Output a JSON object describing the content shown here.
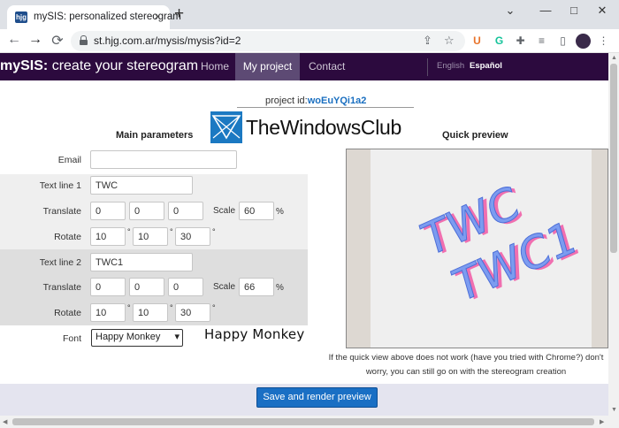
{
  "browser": {
    "tab_favicon": "hjg",
    "tab_title": "mySIS: personalized stereogram",
    "tab_close": "×",
    "new_tab": "+",
    "url": "st.hjg.com.ar/mysis/mysis?id=2",
    "window_controls": {
      "dropdown": "⌄",
      "minimize": "—",
      "maximize": "□",
      "close": "✕"
    },
    "nav": {
      "back": "←",
      "forward": "→",
      "reload": "⟳"
    },
    "extensions": [
      {
        "name": "ublock-icon",
        "glyph": "U",
        "color": "#e8732a"
      },
      {
        "name": "grammarly-icon",
        "glyph": "G",
        "color": "#15c39a"
      },
      {
        "name": "puzzle-icon",
        "glyph": "✚",
        "color": "#5f6368"
      },
      {
        "name": "media-icon",
        "glyph": "≡",
        "color": "#5f6368"
      },
      {
        "name": "sidepanel-icon",
        "glyph": "▯",
        "color": "#5f6368"
      }
    ]
  },
  "site": {
    "brand_strong": "mySIS:",
    "brand_rest": " create your stereogram",
    "menu": [
      {
        "label": "Home",
        "active": false
      },
      {
        "label": "My project",
        "active": true
      },
      {
        "label": "Contact",
        "active": false
      }
    ],
    "langs": [
      {
        "label": "English",
        "active": false
      },
      {
        "label": "Español",
        "active": true
      }
    ]
  },
  "project": {
    "label": "project id:",
    "id": "woEuYQi1a2"
  },
  "watermark": {
    "text": "TheWindowsClub"
  },
  "sections": {
    "main": "Main parameters",
    "preview": "Quick preview"
  },
  "form": {
    "email_label": "Email",
    "email_value": "",
    "line1": {
      "label": "Text line 1",
      "text": "TWC",
      "translate_label": "Translate",
      "translate": [
        "0",
        "0",
        "0"
      ],
      "scale_label": "Scale",
      "scale": "60",
      "scale_unit": "%",
      "rotate_label": "Rotate",
      "rotate": [
        "10",
        "10",
        "30"
      ],
      "deg": "°"
    },
    "line2": {
      "label": "Text line 2",
      "text": "TWC1",
      "translate_label": "Translate",
      "translate": [
        "0",
        "0",
        "0"
      ],
      "scale_label": "Scale",
      "scale": "66",
      "scale_unit": "%",
      "rotate_label": "Rotate",
      "rotate": [
        "10",
        "10",
        "30"
      ],
      "deg": "°"
    },
    "font_label": "Font",
    "font_value": "Happy Monkey",
    "font_preview": "Happy Monkey"
  },
  "preview": {
    "word1": "TWC",
    "word2": "TWC1"
  },
  "note": "If the quick view above does not work (have you tried with Chrome?) don't worry, you can still go on with the stereogram creation",
  "save_button": "Save and render preview"
}
